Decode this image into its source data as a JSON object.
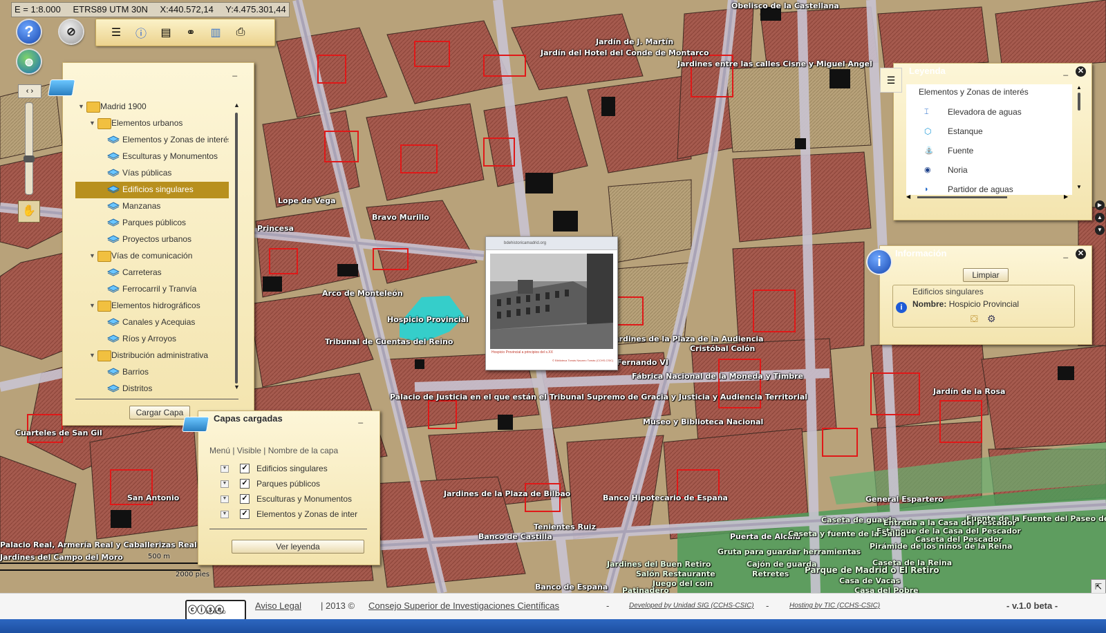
{
  "coordinates": {
    "scale": "E = 1:8.000",
    "crs": "ETRS89 UTM 30N",
    "x": "X:440.572,14",
    "y": "Y:4.475.301,44"
  },
  "buttons": {
    "help": "?"
  },
  "layer_tree": {
    "root": "Madrid 1900",
    "groups": [
      {
        "label": "Elementos urbanos",
        "items": [
          "Elementos y Zonas de interés",
          "Esculturas y Monumentos",
          "Vías públicas",
          "Edificios singulares",
          "Manzanas",
          "Parques públicos",
          "Proyectos urbanos"
        ]
      },
      {
        "label": "Vías de comunicación",
        "items": [
          "Carreteras",
          "Ferrocarril y Tranvía"
        ]
      },
      {
        "label": "Elementos hidrográficos",
        "items": [
          "Canales y Acequias",
          "Ríos y Arroyos"
        ]
      },
      {
        "label": "Distribución administrativa",
        "items": [
          "Barrios",
          "Distritos"
        ]
      }
    ],
    "selected": "Edificios singulares",
    "load_button": "Cargar Capa"
  },
  "loaded_layers": {
    "title": "Capas cargadas",
    "header": "Menú | Visible | Nombre de la capa",
    "layers": [
      "Edificios singulares",
      "Parques públicos",
      "Esculturas y Monumentos",
      "Elementos y Zonas de inter"
    ],
    "legend_button": "Ver leyenda"
  },
  "legend": {
    "title": "Leyenda",
    "section": "Elementos y Zonas de interés",
    "items": [
      "Elevadora de aguas",
      "Estanque",
      "Fuente",
      "Noria",
      "Partidor de aguas"
    ]
  },
  "info": {
    "title": "Información",
    "clear_button": "Limpiar",
    "layer": "Edificios singulares",
    "field_label": "Nombre:",
    "field_value": "Hospicio Provincial"
  },
  "popup": {
    "url": "bdehistoricamadrid.org",
    "caption": "Hospicio Provincial a principios del s.XX",
    "credit": "© Biblioteca Tomás Navarro Tomás (CCHS-CSIC)"
  },
  "map_labels": [
    "Obelisco de la Castellana",
    "Jardín de J. Martín",
    "Jardín del Hotel del Conde de Montarco",
    "Jardines entre las calles Cisne y Miguel Angel",
    "Lope de Vega",
    "Bravo Murillo",
    "Princesa",
    "Arco de Monteleón",
    "Hospicio Provincial",
    "Tribunal de Cuentas del Reino",
    "Jardines de la Plaza de la Audiencia",
    "Cristóbal Colón",
    "Fernando VI",
    "Fábrica Nacional de la Moneda y Timbre",
    "Palacio de Justicia en el que están el Tribunal Supremo de Gracia y Justicia y Audiencia Territorial",
    "Museo y Biblioteca Nacional",
    "Jardín de la Rosa",
    "Cuarteles de San Gil",
    "Jardines de la Plaza de Bilbao",
    "Banco Hipotecario de España",
    "General Espartero",
    "Tenientes Ruiz",
    "Banco de Castilla",
    "Palacio Real, Armería Real y Caballerizas Real",
    "Jardines del Campo del Moro",
    "Puerta de Alcalá",
    "Jardines del Buen Retiro",
    "Fuente de la Fuente del Paseo de Coches",
    "Parque de Madrid o El Retiro",
    "Banco de España",
    "San Antonio",
    "Casa de Vacas",
    "Gruta para guardar herramientas",
    "Salón Restaurante",
    "Juego del coin",
    "Patinadero",
    "Cajón de guarda",
    "Retretes",
    "Caseta de guarda",
    "Caseta de la Reina",
    "Casa del Pobre",
    "Estanque de la Casa del Pescador",
    "Pirámide de los niños de la Reina",
    "Caseta y fuente de la Salud",
    "Entrada a la Casa del Pescador",
    "Caseta del Pescador"
  ],
  "scalebar": {
    "top": "500 m",
    "bottom": "2000 pies"
  },
  "footer": {
    "license": "BY NC ND",
    "legal": "Aviso Legal",
    "year": "| 2013 ©",
    "org": "Consejo Superior de Investigaciones Científicas",
    "dash1": "-",
    "developed": "Developed by Unidad SIG (CCHS-CSIC)",
    "dash2": "-",
    "hosting": "Hosting by TIC (CCHS-CSIC)",
    "version": "- v.1.0 beta -"
  },
  "colors": {
    "panel": "#f6e9b8",
    "selected": "#b8901e",
    "highlight": "#27d3d3",
    "buildings": "#c04a4a",
    "parks": "#4e9c5a"
  }
}
